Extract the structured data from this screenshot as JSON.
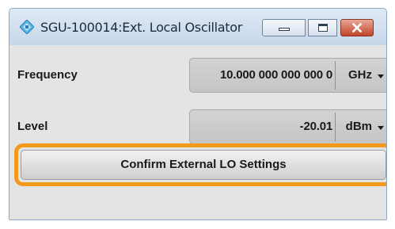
{
  "window": {
    "title": "SGU-100014:Ext. Local Oscillator",
    "icon": "rs-dialog-icon"
  },
  "caption_buttons": {
    "minimize_icon": "minimize-icon",
    "maximize_icon": "maximize-icon",
    "close_icon": "close-icon",
    "close_color": "#c2442a"
  },
  "frequency": {
    "label": "Frequency",
    "value": "10.000 000 000 000 0",
    "unit": "GHz"
  },
  "level": {
    "label": "Level",
    "value": "-20.01",
    "unit": "dBm"
  },
  "confirm": {
    "label": "Confirm External LO Settings",
    "highlight_color": "#f39a1c"
  }
}
